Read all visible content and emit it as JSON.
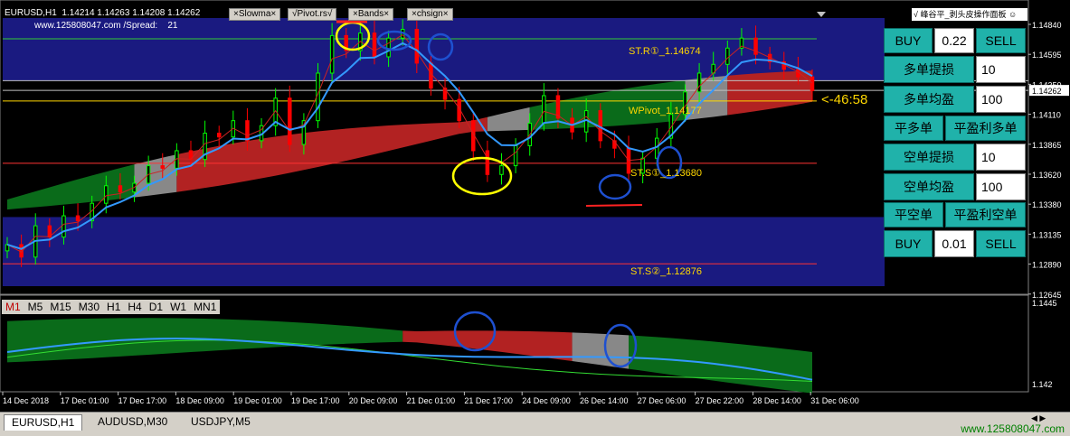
{
  "header": {
    "symbol_tf": "EURUSD,H1",
    "ohlc": "1.14214 1.14263 1.14208 1.14262",
    "site_spread": "www.125808047.com /Spread:",
    "spread_value": "21",
    "indicators": [
      "×Slowma×",
      "√Pivot.rs√",
      "×Bands×",
      "×chsign×"
    ],
    "logo_text": "峰谷平_剥头皮操作面板"
  },
  "pivot_labels": {
    "r1": "ST.R①_1.14674",
    "wpivot": "WPivot_1.14177",
    "s1": "ST.S①_1.13680",
    "s2": "ST.S②_1.12876"
  },
  "countdown": "<-46:58",
  "price_axis": {
    "labels": [
      "1.14840",
      "1.14595",
      "1.14350",
      "1.14110",
      "1.13865",
      "1.13620",
      "1.13380",
      "1.13135",
      "1.12890",
      "1.12645"
    ],
    "current_price": "1.14262"
  },
  "sub_axis": {
    "labels": [
      "1.1445",
      "1.142"
    ]
  },
  "time_axis": [
    "14 Dec 2018",
    "17 Dec 01:00",
    "17 Dec 17:00",
    "18 Dec 09:00",
    "19 Dec 01:00",
    "19 Dec 17:00",
    "20 Dec 09:00",
    "21 Dec 01:00",
    "21 Dec 17:00",
    "24 Dec 09:00",
    "26 Dec 14:00",
    "27 Dec 06:00",
    "27 Dec 22:00",
    "28 Dec 14:00",
    "31 Dec 06:00"
  ],
  "timeframes": [
    "M1",
    "M5",
    "M15",
    "M30",
    "H1",
    "H4",
    "D1",
    "W1",
    "MN1"
  ],
  "active_timeframe": "M1",
  "panel": {
    "buy1": "BUY",
    "lot1": "0.22",
    "sell1": "SELL",
    "long_sl": "多单提损",
    "long_sl_val": "10",
    "long_tp": "多单均盈",
    "long_tp_val": "100",
    "close_long": "平多单",
    "close_long_profit": "平盈利多单",
    "short_sl": "空单提损",
    "short_sl_val": "10",
    "short_tp": "空单均盈",
    "short_tp_val": "100",
    "close_short": "平空单",
    "close_short_profit": "平盈利空单",
    "buy2": "BUY",
    "lot2": "0.01",
    "sell2": "SELL"
  },
  "symbol_tabs": [
    "EURUSD,H1",
    "AUDUSD,M30",
    "USDJPY,M5"
  ],
  "watermark": "www.125808047.com",
  "colors": {
    "zone": "#1a1a80",
    "bull": "#00ff00",
    "bear": "#ff0000",
    "ma_fast": "#3399ff",
    "ribbon_bear": "#b22222",
    "ribbon_bull": "#0a6b1a",
    "pivot_text": "#ffd700",
    "annotation_yellow": "#ffff00",
    "annotation_blue": "#1e50d0"
  },
  "chart_data": {
    "type": "candlestick",
    "symbol": "EURUSD",
    "timeframe": "H1",
    "x_range": [
      "14 Dec 2018",
      "31 Dec 06:00"
    ],
    "ylim": [
      1.1264,
      1.1484
    ],
    "last_price": 1.14262,
    "levels": [
      {
        "name": "ST.R①",
        "value": 1.14674
      },
      {
        "name": "WPivot",
        "value": 1.14177
      },
      {
        "name": "ST.S①",
        "value": 1.1368
      },
      {
        "name": "ST.S②",
        "value": 1.12876
      }
    ],
    "close_path": [
      1.1303,
      1.1293,
      1.1318,
      1.1309,
      1.1326,
      1.1322,
      1.1336,
      1.135,
      1.1345,
      1.1352,
      1.1366,
      1.1364,
      1.1378,
      1.1371,
      1.1392,
      1.1389,
      1.1402,
      1.1386,
      1.1398,
      1.142,
      1.1383,
      1.1402,
      1.144,
      1.147,
      1.1458,
      1.1472,
      1.1453,
      1.1468,
      1.1475,
      1.1448,
      1.1428,
      1.1419,
      1.1402,
      1.1378,
      1.1359,
      1.1366,
      1.1382,
      1.14,
      1.1422,
      1.1404,
      1.1393,
      1.141,
      1.1386,
      1.138,
      1.136,
      1.1372,
      1.1388,
      1.1407,
      1.1425,
      1.144,
      1.1447,
      1.146,
      1.1468,
      1.1455,
      1.1449,
      1.1443,
      1.1437,
      1.1426
    ],
    "sub_indicator": {
      "ylim": [
        1.1415,
        1.145
      ]
    }
  }
}
